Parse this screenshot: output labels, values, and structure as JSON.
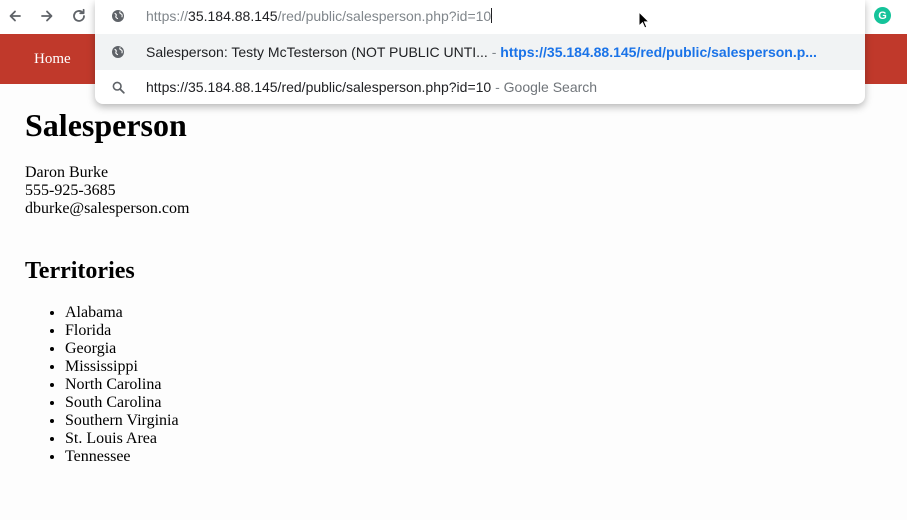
{
  "browser": {
    "omnibox": {
      "url_scheme": "https://",
      "url_host": "35.184.88.145",
      "url_path": "/red/public/salesperson.php?id=10",
      "suggestions": [
        {
          "title": "Salesperson: Testy McTesterson (NOT PUBLIC UNTI...",
          "separator": " - ",
          "url": "https://35.184.88.145/red/public/salesperson.p...",
          "icon": "globe-icon"
        },
        {
          "title": "https://35.184.88.145/red/public/salesperson.php?id=10",
          "separator": " - ",
          "source": "Google Search",
          "icon": "search-icon"
        }
      ]
    },
    "extension_badge": "G"
  },
  "site_nav": {
    "home_label": "Home",
    "bar_color": "#c0392b"
  },
  "page": {
    "title": "Salesperson",
    "contact": {
      "name": "Daron Burke",
      "phone": "555-925-3685",
      "email": "dburke@salesperson.com"
    },
    "territories_title": "Territories",
    "territories": [
      "Alabama",
      "Florida",
      "Georgia",
      "Mississippi",
      "North Carolina",
      "South Carolina",
      "Southern Virginia",
      "St. Louis Area",
      "Tennessee"
    ]
  }
}
